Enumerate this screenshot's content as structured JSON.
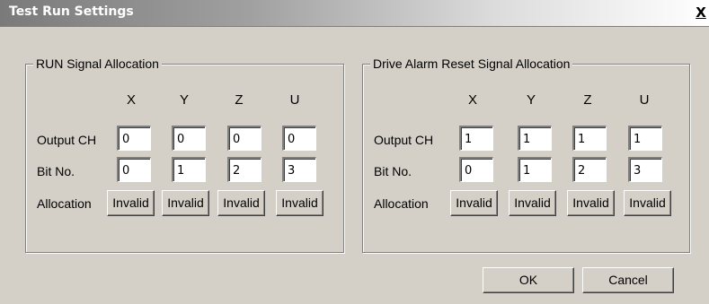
{
  "window": {
    "title": "Test Run Settings",
    "close_label": "X"
  },
  "run_group": {
    "title": "RUN Signal Allocation",
    "axes": [
      "X",
      "Y",
      "Z",
      "U"
    ],
    "output_ch_label": "Output CH",
    "bit_no_label": "Bit No.",
    "allocation_label": "Allocation",
    "output_ch": [
      "0",
      "0",
      "0",
      "0"
    ],
    "bit_no": [
      "0",
      "1",
      "2",
      "3"
    ],
    "allocation": [
      "Invalid",
      "Invalid",
      "Invalid",
      "Invalid"
    ]
  },
  "reset_group": {
    "title": "Drive Alarm Reset Signal Allocation",
    "axes": [
      "X",
      "Y",
      "Z",
      "U"
    ],
    "output_ch_label": "Output CH",
    "bit_no_label": "Bit No.",
    "allocation_label": "Allocation",
    "output_ch": [
      "1",
      "1",
      "1",
      "1"
    ],
    "bit_no": [
      "0",
      "1",
      "2",
      "3"
    ],
    "allocation": [
      "Invalid",
      "Invalid",
      "Invalid",
      "Invalid"
    ]
  },
  "buttons": {
    "ok": "OK",
    "cancel": "Cancel"
  }
}
